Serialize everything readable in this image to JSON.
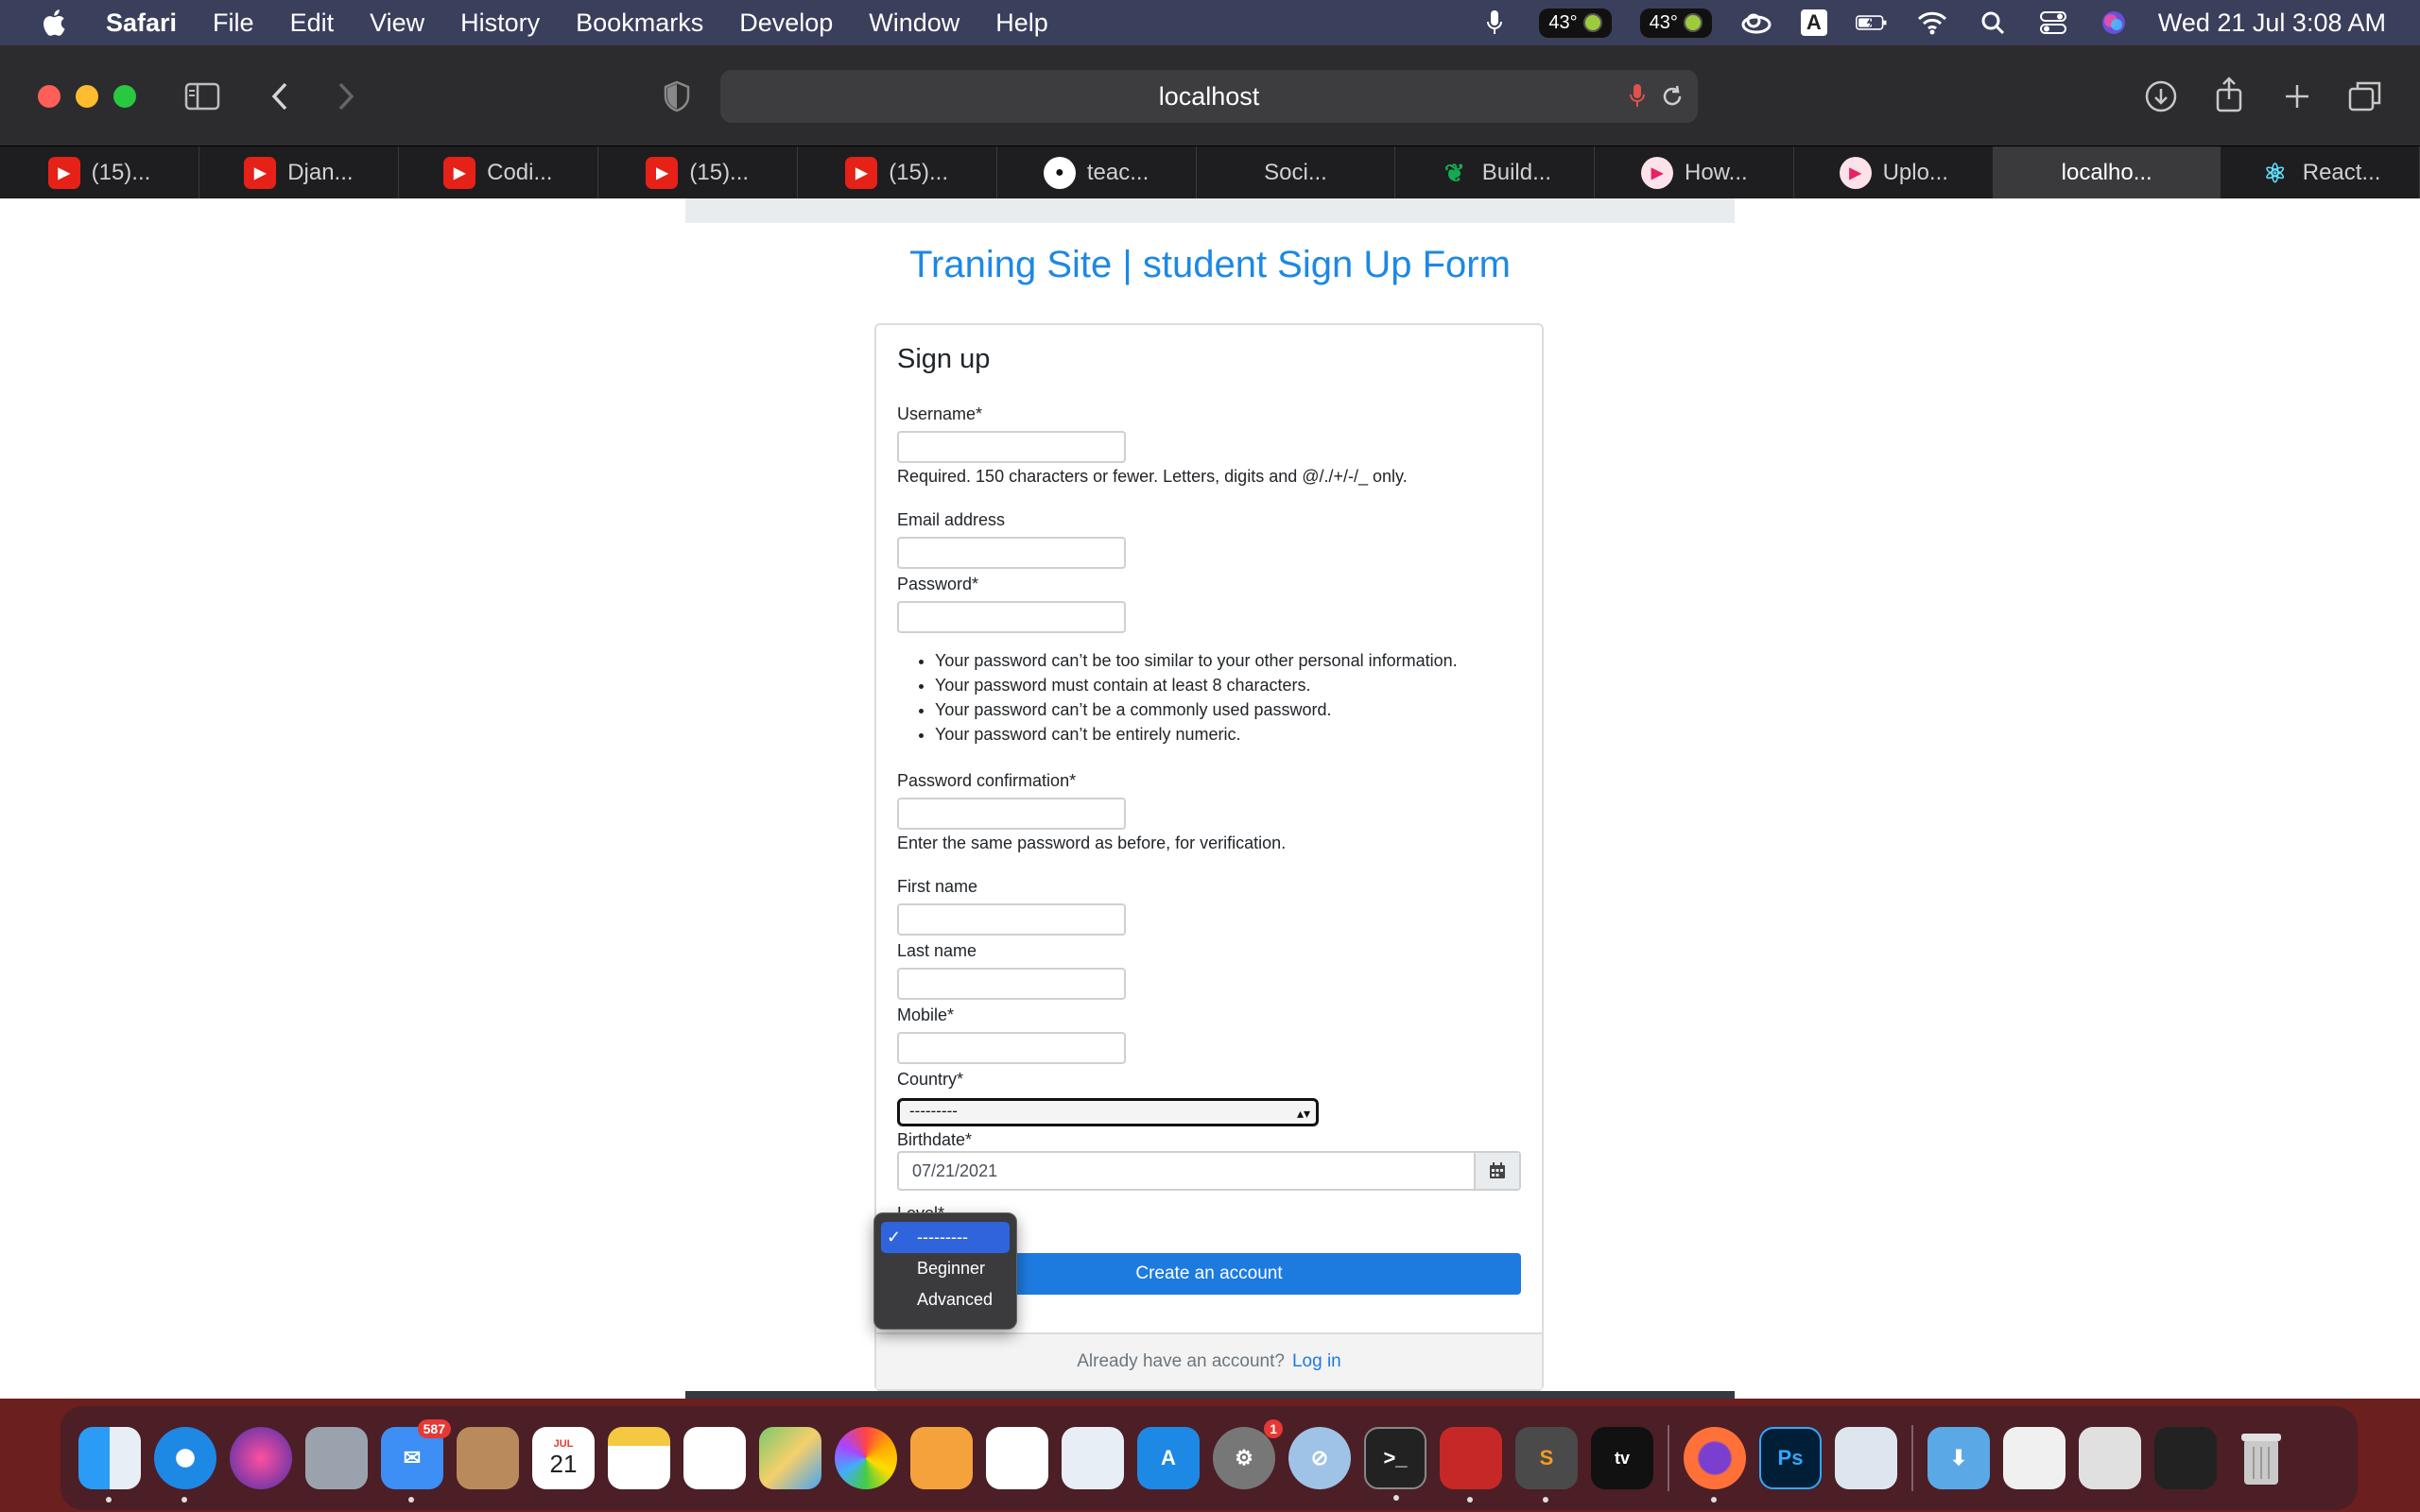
{
  "menubar": {
    "items": [
      "Safari",
      "File",
      "Edit",
      "View",
      "History",
      "Bookmarks",
      "Develop",
      "Window",
      "Help"
    ],
    "temp1": "43°",
    "temp2": "43°",
    "input_source": "A",
    "datetime": "Wed 21 Jul  3:08 AM"
  },
  "browser": {
    "url": "localhost",
    "tabs": [
      {
        "label": "(15)...",
        "icon": "youtube-icon",
        "color": "#e62117"
      },
      {
        "label": "Djan...",
        "icon": "youtube-icon",
        "color": "#e62117"
      },
      {
        "label": "Codi...",
        "icon": "youtube-icon",
        "color": "#e62117"
      },
      {
        "label": "(15)...",
        "icon": "youtube-icon",
        "color": "#e62117"
      },
      {
        "label": "(15)...",
        "icon": "youtube-icon",
        "color": "#e62117"
      },
      {
        "label": "teac...",
        "icon": "github-icon",
        "color": "#ffffff"
      },
      {
        "label": "Soci...",
        "icon": "",
        "color": ""
      },
      {
        "label": "Build...",
        "icon": "leaf-icon",
        "color": "#13aa52"
      },
      {
        "label": "How...",
        "icon": "play-icon",
        "color": "#e91e63"
      },
      {
        "label": "Uplo...",
        "icon": "play-icon",
        "color": "#e91e63"
      },
      {
        "label": "localho...",
        "icon": "",
        "color": ""
      },
      {
        "label": "React...",
        "icon": "react-icon",
        "color": "#61dafb"
      }
    ]
  },
  "form": {
    "page_title": "Traning Site | student Sign Up Form",
    "heading": "Sign up",
    "username_label": "Username*",
    "username_help": "Required. 150 characters or fewer. Letters, digits and @/./+/-/_ only.",
    "email_label": "Email address",
    "password_label": "Password*",
    "password_rules": [
      "Your password can’t be too similar to your other personal information.",
      "Your password must contain at least 8 characters.",
      "Your password can’t be a commonly used password.",
      "Your password can’t be entirely numeric."
    ],
    "password2_label": "Password confirmation*",
    "password2_help": "Enter the same password as before, for verification.",
    "first_name_label": "First name",
    "last_name_label": "Last name",
    "mobile_label": "Mobile*",
    "country_label": "Country*",
    "country_value": "---------",
    "birthdate_label": "Birthdate*",
    "birthdate_value": "07/21/2021",
    "level_label": "Level*",
    "level_options": [
      "---------",
      "Beginner",
      "Advanced"
    ],
    "submit_label": "Create an account",
    "footer_text": "Already have an account?",
    "login_link": "Log in"
  },
  "dock": {
    "mail_badge": "587",
    "calendar_month": "JUL",
    "calendar_day": "21",
    "settings_badge": "1"
  }
}
